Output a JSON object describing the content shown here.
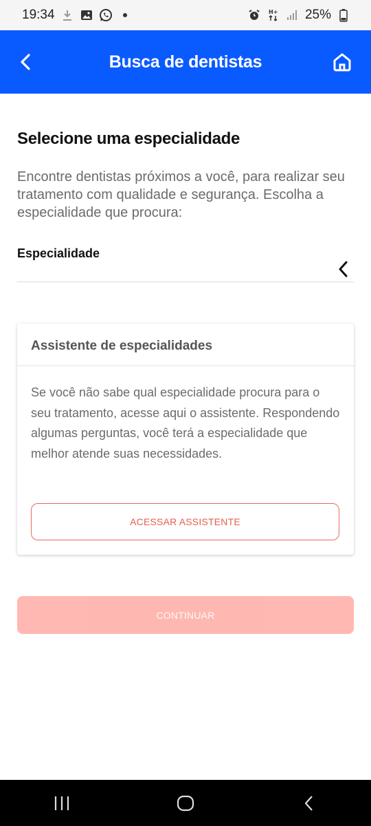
{
  "status_bar": {
    "time": "19:34",
    "battery": "25%",
    "left_icons": [
      "download-icon",
      "image-icon",
      "whatsapp-icon",
      "dot-icon"
    ],
    "right_icons": [
      "alarm-icon",
      "data-icon",
      "signal-icon",
      "battery-icon"
    ]
  },
  "app_bar": {
    "title": "Busca de dentistas",
    "back_icon": "chevron-left-icon",
    "home_icon": "home-icon",
    "color": "#0a5bff"
  },
  "main": {
    "heading": "Selecione uma especialidade",
    "description": "Encontre dentistas próximos a você, para realizar seu tratamento com qualidade e segurança. Escolha a especialidade que procura:",
    "field": {
      "label": "Especialidade",
      "value": "",
      "icon": "chevron-left-icon"
    }
  },
  "assistant_card": {
    "title": "Assistente de especialidades",
    "body": "Se você não sabe qual especialidade procura para o seu tratamento, acesse aqui o assistente. Respondendo algumas perguntas, você terá a especialidade que melhor atende suas necessidades.",
    "button_label": "ACESSAR ASSISTENTE",
    "button_color": "#e5604f"
  },
  "continue_button": {
    "label": "CONTINUAR",
    "state": "disabled",
    "color": "#ffb0aa"
  },
  "nav_bar": {
    "icons": [
      "recent-apps-icon",
      "home-circle-icon",
      "back-icon"
    ]
  }
}
